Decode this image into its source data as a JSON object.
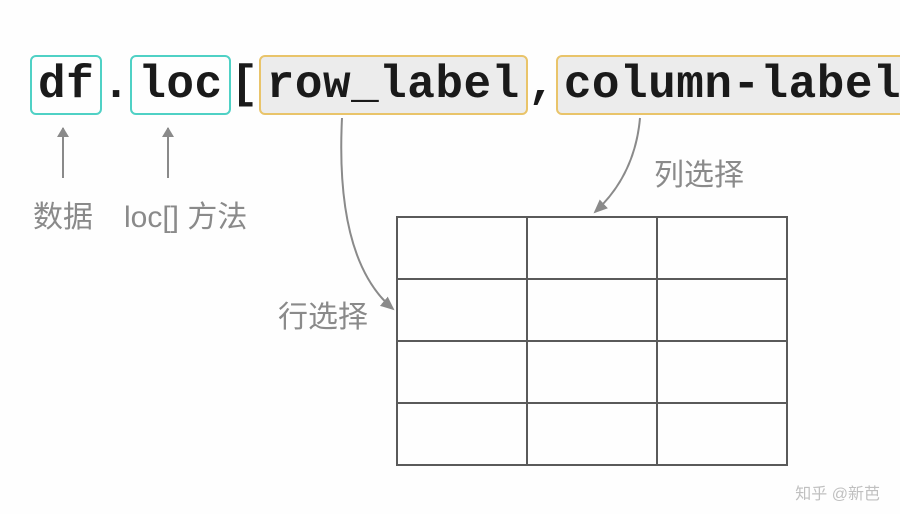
{
  "code": {
    "df": "df",
    "dot": ".",
    "loc": "loc",
    "lbrack": "[",
    "row_label": "row_label",
    "comma": ",",
    "column_label": "column-label",
    "rbrack": "]"
  },
  "labels": {
    "data": "数据",
    "loc_method": "loc[] 方法",
    "row_select": "行选择",
    "col_select": "列选择"
  },
  "watermark": "知乎 @新芭"
}
